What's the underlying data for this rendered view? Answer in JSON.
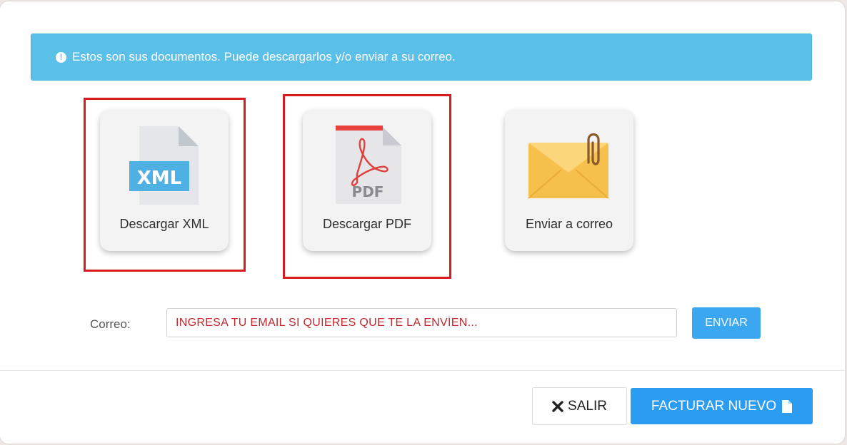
{
  "alert": {
    "text": "Estos son sus documentos. Puede descargarlos y/o enviar a su correo.",
    "icon": "exclamation-icon"
  },
  "cards": [
    {
      "label": "Descargar XML",
      "icon_text": "XML",
      "icon": "xml-file-icon"
    },
    {
      "label": "Descargar PDF",
      "icon_text": "PDF",
      "icon": "pdf-file-icon"
    },
    {
      "label": "Enviar a correo",
      "icon": "envelope-paperclip-icon"
    }
  ],
  "form": {
    "label": "Correo:",
    "placeholder": "INGRESA TU EMAIL SI QUIERES QUE TE LA ENVÍEN...",
    "value": "",
    "send_label": "ENVIAR"
  },
  "footer": {
    "exit_label": "SALIR",
    "new_label": "FACTURAR NUEVO"
  },
  "colors": {
    "alert_bg": "#5bc0e8",
    "primary": "#2b9cf0",
    "highlight": "#d71920",
    "placeholder": "#c0282d"
  }
}
